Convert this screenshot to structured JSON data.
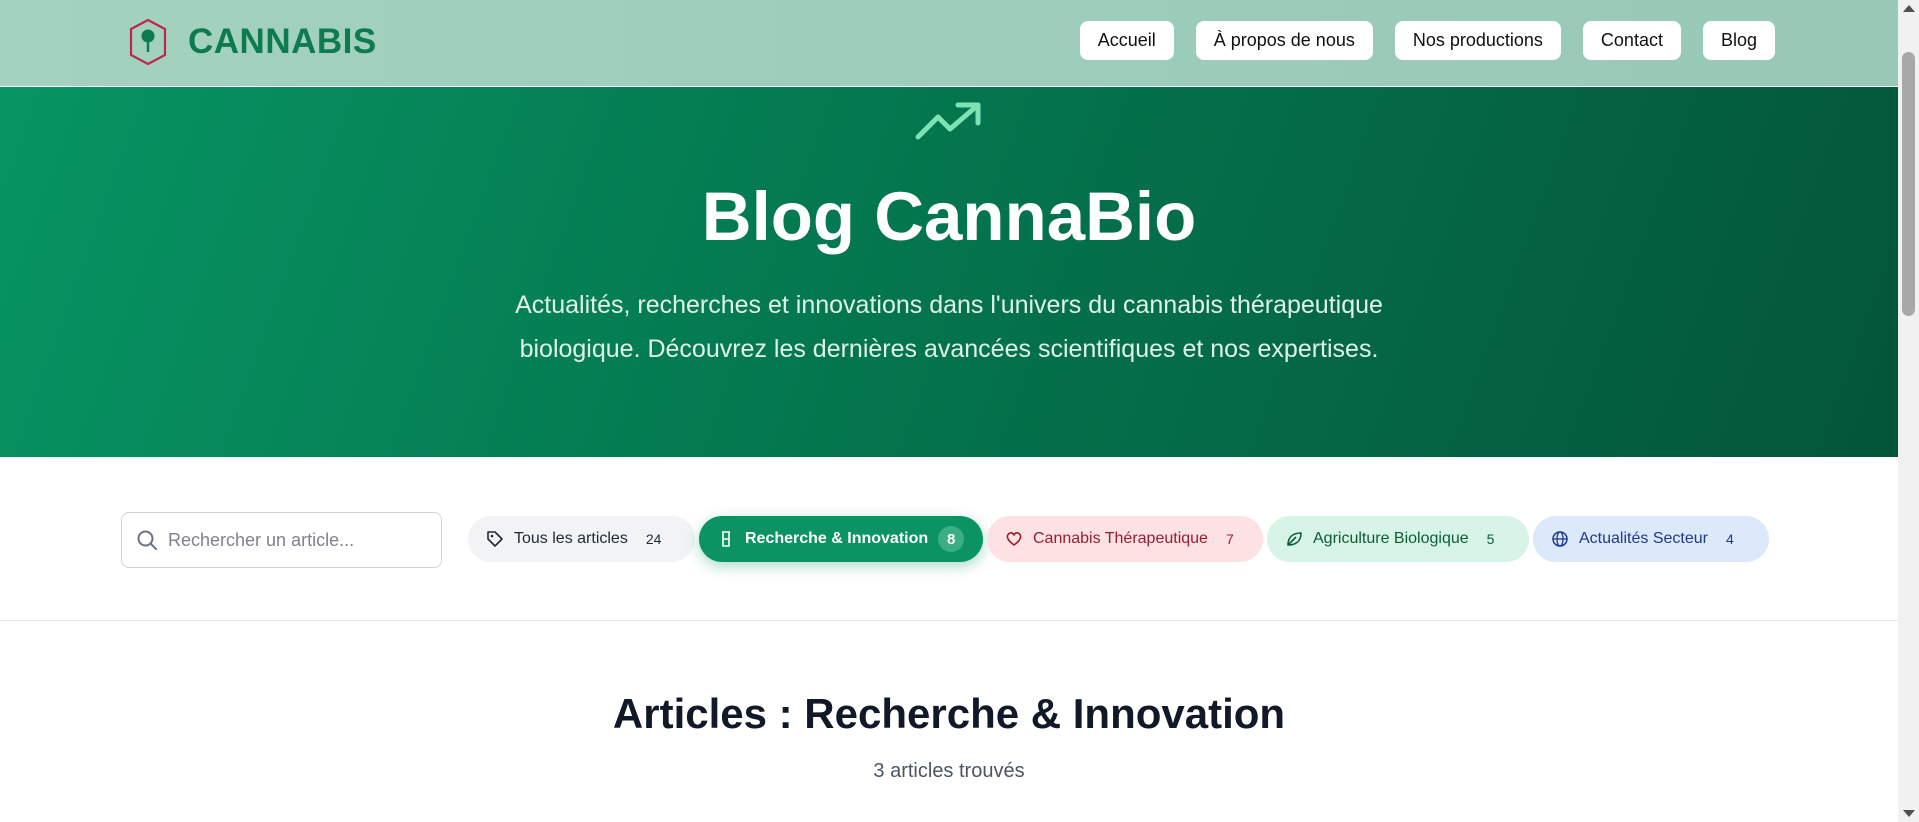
{
  "brand": {
    "name": "CANNABIS",
    "icon": "shield-leaf-icon"
  },
  "nav": {
    "items": [
      {
        "label": "Accueil"
      },
      {
        "label": "À propos de nous"
      },
      {
        "label": "Nos productions"
      },
      {
        "label": "Contact"
      },
      {
        "label": "Blog"
      }
    ]
  },
  "hero": {
    "icon": "trending-up-icon",
    "title": "Blog CannaBio",
    "subtitle_line1": "Actualités, recherches et innovations dans l'univers du cannabis thérapeutique",
    "subtitle_line2": "biologique. Découvrez les dernières avancées scientifiques et nos expertises."
  },
  "search": {
    "placeholder": "Rechercher un article...",
    "value": ""
  },
  "categories": [
    {
      "label": "Tous les articles",
      "count": "24",
      "icon": "tag-icon",
      "active": false
    },
    {
      "label": "Recherche & Innovation",
      "count": "8",
      "icon": "flask-icon",
      "active": true
    },
    {
      "label": "Cannabis Thérapeutique",
      "count": "7",
      "icon": "heart-icon",
      "active": false
    },
    {
      "label": "Agriculture Biologique",
      "count": "5",
      "icon": "leaf-icon",
      "active": false
    },
    {
      "label": "Actualités Secteur",
      "count": "4",
      "icon": "globe-icon",
      "active": false
    }
  ],
  "articles": {
    "title": "Articles : Recherche & Innovation",
    "count_text": "3 articles trouvés"
  },
  "colors": {
    "brand_green": "#0d7a4f",
    "hero_start": "#079463",
    "hero_end": "#04553a",
    "active_chip": "#0b9461"
  }
}
